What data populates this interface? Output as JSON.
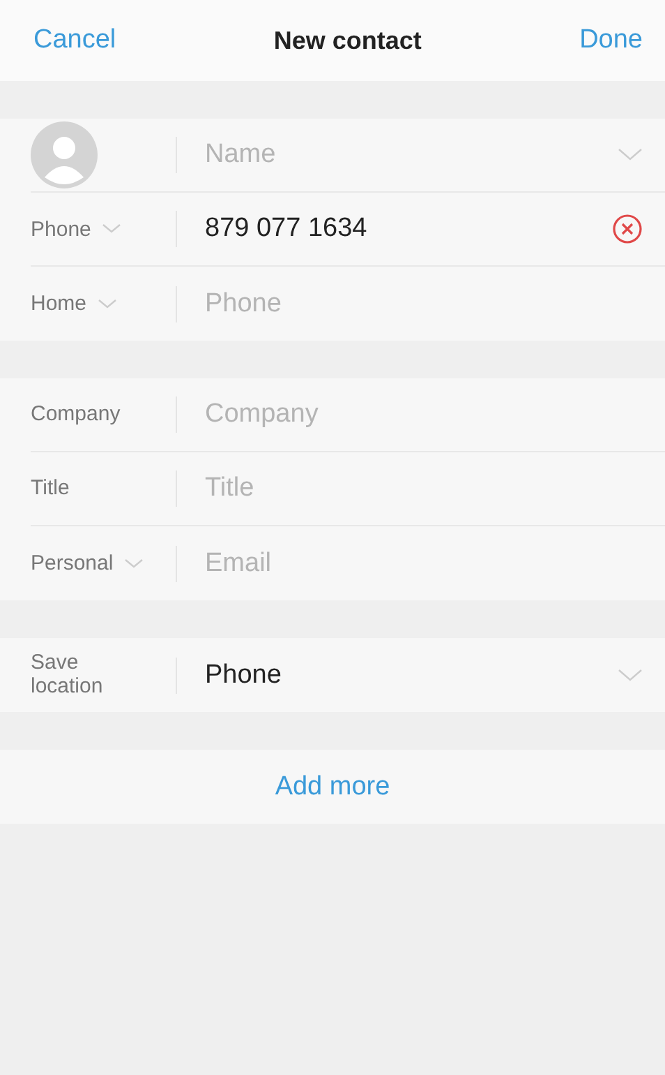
{
  "header": {
    "cancel": "Cancel",
    "title": "New contact",
    "done": "Done"
  },
  "sections": [
    {
      "rows": [
        {
          "kind": "avatar",
          "placeholder": "Name",
          "expand": true
        },
        {
          "kind": "field",
          "label": "Phone",
          "label_dropdown": true,
          "value": "879 077 1634",
          "clearable": true
        },
        {
          "kind": "field",
          "label": "Home",
          "label_dropdown": true,
          "placeholder": "Phone"
        }
      ]
    },
    {
      "rows": [
        {
          "kind": "field",
          "label": "Company",
          "label_dropdown": false,
          "placeholder": "Company"
        },
        {
          "kind": "field",
          "label": "Title",
          "label_dropdown": false,
          "placeholder": "Title"
        },
        {
          "kind": "field",
          "label": "Personal",
          "label_dropdown": true,
          "placeholder": "Email"
        }
      ]
    },
    {
      "rows": [
        {
          "kind": "field",
          "label": "Save\nlocation",
          "label_dropdown": false,
          "value": "Phone",
          "expand": true
        }
      ]
    }
  ],
  "add_more": "Add more"
}
